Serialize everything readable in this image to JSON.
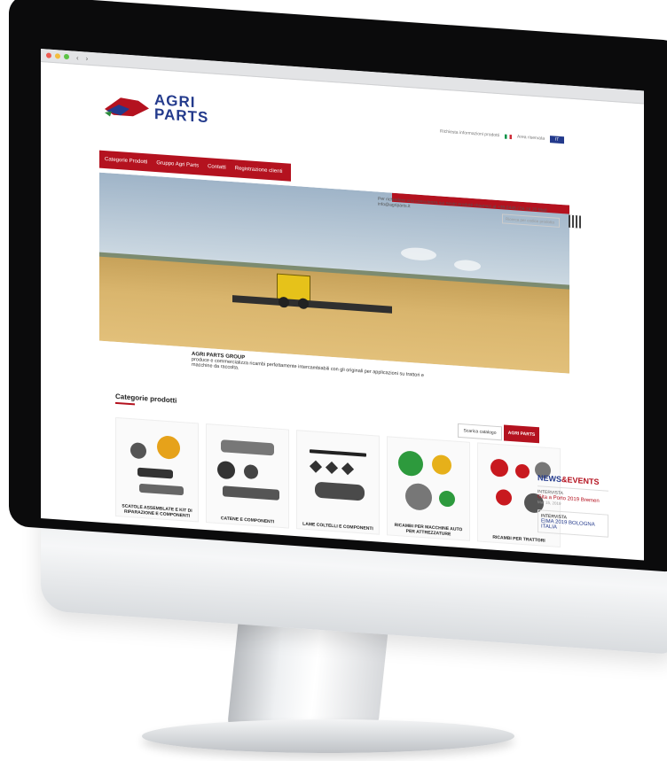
{
  "browser": {
    "nav_back": "‹",
    "nav_fwd": "›"
  },
  "brand": {
    "line1": "AGRI",
    "line2": "PARTS"
  },
  "top_links": {
    "left": "Richiesta informazioni prodotti",
    "right": "Area riservata",
    "lang": "IT"
  },
  "nav": [
    "Categorie Prodotti",
    "Gruppo Agri Parts",
    "Contatti",
    "Registrazione clienti"
  ],
  "info_strip": "Per richiedere una consulenza sui nostri prodotti chiamaci al +39 0445 / 56 24 20 Mail: info@agriparts.it",
  "search": {
    "placeholder": "Ricerca per codice prodotto"
  },
  "hero_caption": {
    "title": "AGRI PARTS GROUP",
    "text": "produce e commercializza ricambi perfettamente intercambiabili con gli originali per applicazioni su trattori e macchine da raccolta."
  },
  "section": {
    "title": "Categorie prodotti"
  },
  "catalog": {
    "button": "Scarica catalogo",
    "logo": "AGRI PARTS"
  },
  "products": [
    {
      "label": "SCATOLE ASSEMBLATE E KIT DI RIPARAZIONE E COMPONENTI"
    },
    {
      "label": "CATENE E COMPONENTI"
    },
    {
      "label": "LAME COLTELLI E COMPONENTI"
    },
    {
      "label": "RICAMBI PER MACCHINE AUTO PER ATTREZZATURE"
    },
    {
      "label": "RICAMBI PER TRATTORI"
    }
  ],
  "news": {
    "title_a": "NEWS",
    "title_b": "&EVENTS",
    "items": [
      {
        "tag": "INTERVISTA",
        "headline": "Gita a Porto 2019 Bremen",
        "date": "Mar 15, 2019"
      },
      {
        "tag": "INTERVISTA",
        "headline": "EIMA 2019 BOLOGNA ITALIA",
        "date": ""
      }
    ]
  },
  "colors": {
    "brand_red": "#b4121f",
    "brand_blue": "#233a8c"
  }
}
